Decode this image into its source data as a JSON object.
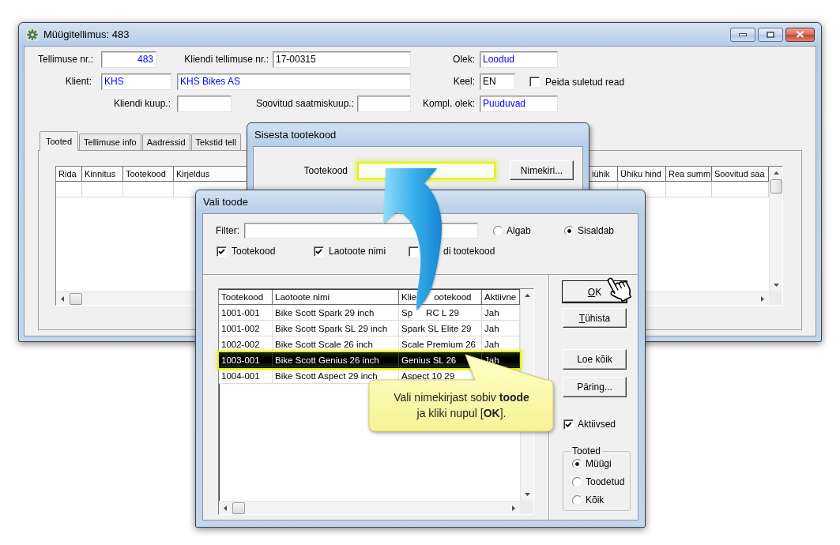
{
  "main_window": {
    "title": "Müügitellimus: 483",
    "fields": [
      {
        "kind": "field",
        "label": "Tellimuse nr.:",
        "value": "483",
        "readonly": true
      },
      {
        "kind": "field",
        "label": "Kliendi tellimuse nr.:",
        "value": "17-00315",
        "readonly": false
      },
      {
        "kind": "field",
        "label": "Olek:",
        "value": "Loodud",
        "readonly": true
      },
      {
        "kind": "field",
        "label": "Klient:",
        "value": "KHS",
        "readonly": true
      },
      {
        "kind": "field",
        "value": "KHS Bikes AS",
        "readonly": true
      },
      {
        "kind": "field",
        "label": "Keel:",
        "value": "EN",
        "readonly": false
      },
      {
        "kind": "checkbox",
        "label": "Peida suletud read",
        "checked": false
      },
      {
        "kind": "field",
        "label": "Kliendi kuup.:"
      },
      {
        "kind": "field",
        "label": "Soovitud saatmiskuup.:"
      },
      {
        "kind": "field",
        "label": "Kompl. olek:",
        "value": "Puuduvad",
        "readonly": true
      }
    ],
    "tabs": [
      {
        "label": "Tooted",
        "selected": true
      },
      {
        "label": "Tellimuse info",
        "selected": false
      },
      {
        "label": "Aadressid",
        "selected": false
      },
      {
        "label": "Tekstid tell",
        "selected": false
      }
    ],
    "table": {
      "columns": [
        "Rida",
        "Kinnitus",
        "Tootekood",
        "Kirjeldus",
        "iühik",
        "Ühiku hind",
        "Rea summ",
        "Soovitud saa"
      ]
    }
  },
  "entry_dialog": {
    "title": "Sisesta tootekood",
    "label": "Tootekood",
    "highlighted": true,
    "button": "Nimekiri..."
  },
  "product_dialog": {
    "title": "Vali toode",
    "filter": {
      "label": "Filter:"
    },
    "match_modes": [
      {
        "label": "Algab",
        "selected": false
      },
      {
        "label": "Sisaldab",
        "selected": true
      }
    ],
    "search_in": [
      {
        "label": "Tootekood",
        "checked": true
      },
      {
        "label": "Laotoote nimi",
        "checked": true
      },
      {
        "label": "di tootekood",
        "checked": false
      }
    ],
    "grid": {
      "columns": [
        "Tootekood",
        "Laotoote nimi",
        [
          "Klie",
          "ootekood"
        ],
        "Aktiivne"
      ],
      "rows": [
        {
          "code": "1001-001",
          "name": "Bike Scott Spark 29 inch",
          "customer_code": [
            "Sp",
            "RC L 29"
          ],
          "active": "Jah",
          "selected": false
        },
        {
          "code": "1001-002",
          "name": "Bike Scott Spark SL 29 inch",
          "customer_code": "Spark SL Elite 29",
          "active": "Jah",
          "selected": false
        },
        {
          "code": "1002-002",
          "name": "Bike Scott Scale 26 inch",
          "customer_code": "Scale Premium 26",
          "active": "Jah",
          "selected": false
        },
        {
          "code": "1003-001",
          "name": "Bike Scott Genius 26 inch",
          "customer_code": "Genius SL 26",
          "active": "Jah",
          "selected": true
        },
        {
          "code": "1004-001",
          "name": "Bike Scott Aspect 29 inch",
          "customer_code": "Aspect 10 29",
          "selected": false
        }
      ]
    },
    "buttons": [
      {
        "label": "OK",
        "default": true,
        "underline_first": true
      },
      {
        "label": "Tühista",
        "default": false,
        "underline_first": true
      },
      {
        "label": "Loe kõik",
        "default": false,
        "underline_first": false
      },
      {
        "label": "Päring...",
        "default": false,
        "underline_first": false
      }
    ],
    "active_only": {
      "label": "Aktiivsed",
      "checked": true
    },
    "products_group": {
      "title": "Tooted",
      "options": [
        {
          "label": "Müügi",
          "selected": true
        },
        {
          "label": "Toodetud",
          "selected": false
        },
        {
          "label": "Kõik",
          "selected": false
        }
      ]
    }
  },
  "callout": {
    "text": "Vali nimekirjast sobiv **toode**\nja kliki nupul [**OK**]."
  }
}
